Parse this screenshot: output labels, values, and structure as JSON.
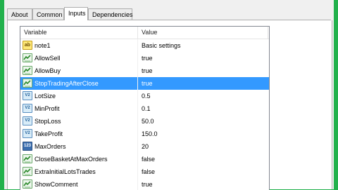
{
  "tabs": [
    {
      "label": "About",
      "active": false
    },
    {
      "label": "Common",
      "active": false
    },
    {
      "label": "Inputs",
      "active": true
    },
    {
      "label": "Dependencies",
      "active": false
    }
  ],
  "columns": {
    "variable": "Variable",
    "value": "Value"
  },
  "rows": [
    {
      "icon": "ab-string-icon",
      "name": "note1",
      "value": "Basic settings",
      "selected": false
    },
    {
      "icon": "bool-icon",
      "name": "AllowSell",
      "value": "true",
      "selected": false
    },
    {
      "icon": "bool-icon",
      "name": "AllowBuy",
      "value": "true",
      "selected": false
    },
    {
      "icon": "bool-icon",
      "name": "StopTradingAfterClose",
      "value": "true",
      "selected": true
    },
    {
      "icon": "double-icon",
      "name": "LotSize",
      "value": "0.5",
      "selected": false
    },
    {
      "icon": "double-icon",
      "name": "MinProfit",
      "value": "0.1",
      "selected": false
    },
    {
      "icon": "double-icon",
      "name": "StopLoss",
      "value": "50.0",
      "selected": false
    },
    {
      "icon": "double-icon",
      "name": "TakeProfit",
      "value": "150.0",
      "selected": false
    },
    {
      "icon": "int-icon",
      "name": "MaxOrders",
      "value": "20",
      "selected": false
    },
    {
      "icon": "bool-icon",
      "name": "CloseBasketAtMaxOrders",
      "value": "false",
      "selected": false
    },
    {
      "icon": "bool-icon",
      "name": "ExtraInitialLotsTrades",
      "value": "false",
      "selected": false
    },
    {
      "icon": "bool-icon",
      "name": "ShowComment",
      "value": "true",
      "selected": false
    }
  ],
  "icon_glyphs": {
    "ab": "ab",
    "double": "V2",
    "int": "123"
  },
  "colors": {
    "background": "#22b14c",
    "selection": "#3399ff"
  }
}
